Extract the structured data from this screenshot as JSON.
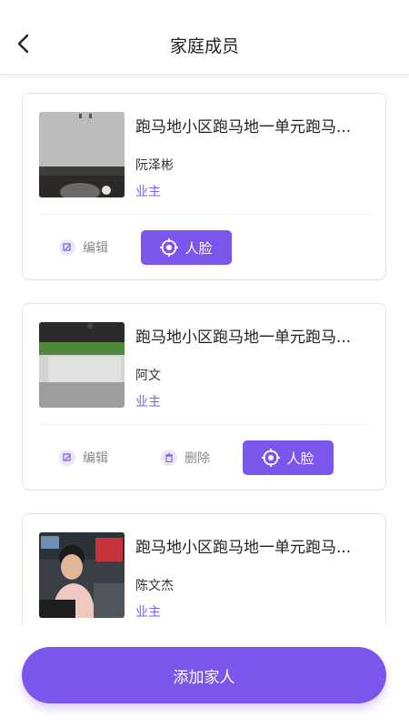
{
  "header": {
    "title": "家庭成员"
  },
  "members": [
    {
      "address": "跑马地小区跑马地一单元跑马...",
      "name": "阮泽彬",
      "role": "业主",
      "edit_label": "编辑",
      "face_label": "人脸"
    },
    {
      "address": "跑马地小区跑马地一单元跑马...",
      "name": "阿文",
      "role": "业主",
      "edit_label": "编辑",
      "delete_label": "删除",
      "face_label": "人脸"
    },
    {
      "address": "跑马地小区跑马地一单元跑马...",
      "name": "陈文杰",
      "role": "业主"
    }
  ],
  "footer": {
    "add_label": "添加家人"
  },
  "colors": {
    "accent": "#7b55ec",
    "role_text": "#7a5cf0",
    "icon_bg": "#ebe7f7"
  }
}
